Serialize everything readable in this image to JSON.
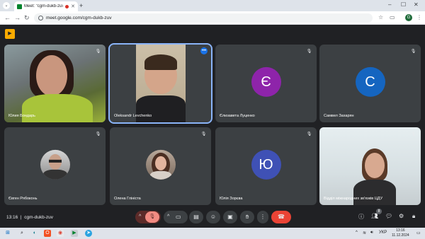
{
  "browser": {
    "tab_title": "Meet: \"cgm-dukb-zuv\"",
    "url": "meet.google.com/cgm-dukb-zuv",
    "new_tab_glyph": "+",
    "profile_initial": "G"
  },
  "meet": {
    "meeting_code": "cgm-dukb-zuv",
    "time": "13:16",
    "participants_count": "8",
    "tiles": [
      {
        "name": "Юлия Бондарь",
        "type": "video",
        "muted": true
      },
      {
        "name": "Oleksandr Levchenko",
        "type": "video",
        "muted": false,
        "speaking": true
      },
      {
        "name": "Єлизавета Луценко",
        "type": "letter",
        "letter": "Є",
        "color": "#8e24aa",
        "muted": true
      },
      {
        "name": "Самвел Захарян",
        "type": "letter",
        "letter": "С",
        "color": "#1565c0",
        "muted": true
      },
      {
        "name": "Євген Рябоконь",
        "type": "photo",
        "muted": true
      },
      {
        "name": "Олена Глінiста",
        "type": "photo",
        "muted": true
      },
      {
        "name": "Юлія Зорєва",
        "type": "letter",
        "letter": "Ю",
        "color": "#3f51b5",
        "muted": true
      },
      {
        "name": "Відділ міжнародних зв'язків ЦДУ",
        "type": "video",
        "muted": true
      }
    ]
  },
  "taskbar": {
    "lang": "УКР",
    "time": "13:16",
    "date": "11.12.2024"
  },
  "colors": {
    "stage_bg": "#202124",
    "tile_bg": "#3c4043",
    "end_call": "#ea4335",
    "active_outline": "#8ab4f8"
  }
}
